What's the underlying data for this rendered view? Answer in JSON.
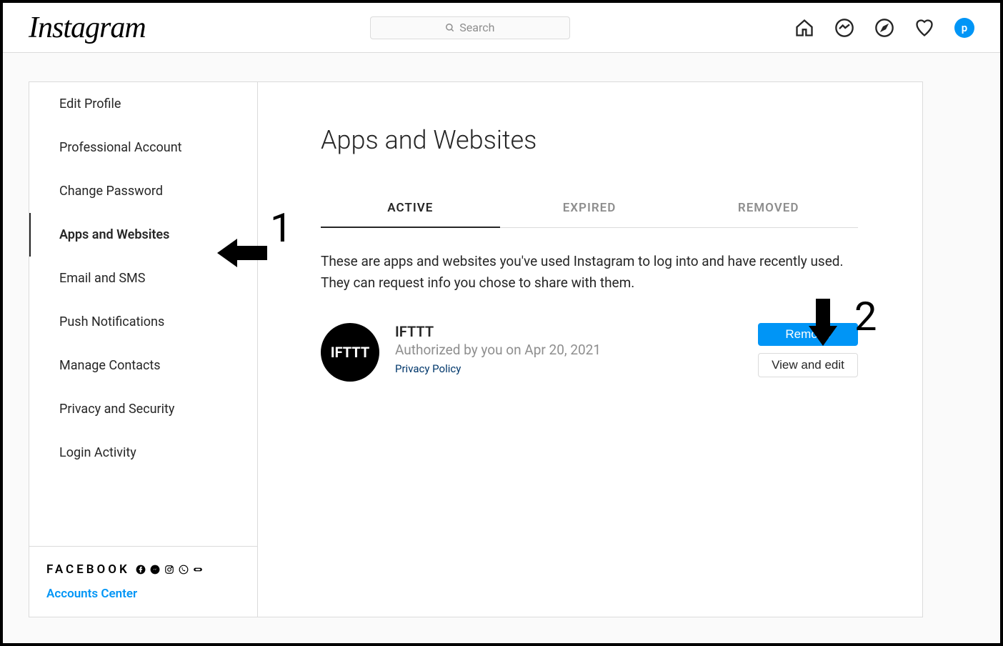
{
  "header": {
    "logo": "Instagram",
    "search_placeholder": "Search",
    "avatar_letter": "p"
  },
  "sidebar": {
    "items": [
      {
        "label": "Edit Profile"
      },
      {
        "label": "Professional Account"
      },
      {
        "label": "Change Password"
      },
      {
        "label": "Apps and Websites"
      },
      {
        "label": "Email and SMS"
      },
      {
        "label": "Push Notifications"
      },
      {
        "label": "Manage Contacts"
      },
      {
        "label": "Privacy and Security"
      },
      {
        "label": "Login Activity"
      }
    ],
    "active_index": 3,
    "footer": {
      "brand": "FACEBOOK",
      "link": "Accounts Center"
    }
  },
  "main": {
    "title": "Apps and Websites",
    "tabs": [
      {
        "label": "ACTIVE"
      },
      {
        "label": "EXPIRED"
      },
      {
        "label": "REMOVED"
      }
    ],
    "active_tab": 0,
    "description": "These are apps and websites you've used Instagram to log into and have recently used. They can request info you chose to share with them.",
    "app": {
      "icon_text": "IFTTT",
      "name": "IFTTT",
      "authorized": "Authorized by you on Apr 20, 2021",
      "privacy": "Privacy Policy",
      "remove": "Remove",
      "view": "View and edit"
    }
  },
  "annotations": {
    "num1": "1",
    "num2": "2"
  }
}
